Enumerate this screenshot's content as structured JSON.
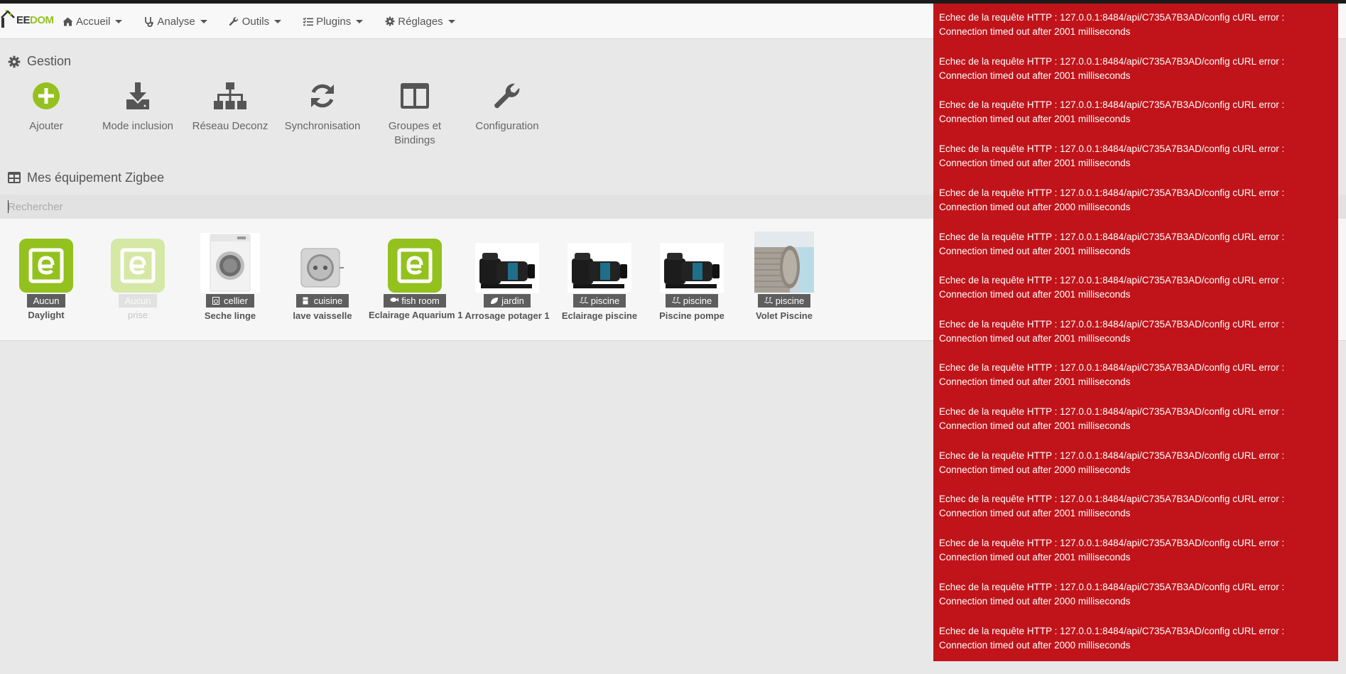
{
  "navbar": {
    "logo": {
      "part1": "EE",
      "part2": "DOM"
    },
    "menu": [
      {
        "label": "Accueil",
        "icon": "home-icon"
      },
      {
        "label": "Analyse",
        "icon": "stethoscope-icon"
      },
      {
        "label": "Outils",
        "icon": "wrench-icon"
      },
      {
        "label": "Plugins",
        "icon": "tasks-icon"
      },
      {
        "label": "Réglages",
        "icon": "gear-icon"
      }
    ]
  },
  "gestion": {
    "title": "Gestion",
    "actions": [
      {
        "label": "Ajouter",
        "icon": "plus-circle-icon",
        "color": "#94c11f"
      },
      {
        "label": "Mode inclusion",
        "icon": "download-icon"
      },
      {
        "label": "Réseau Deconz",
        "icon": "sitemap-icon"
      },
      {
        "label": "Synchronisation",
        "icon": "refresh-icon"
      },
      {
        "label": "Groupes et Bindings",
        "label_line1": "Groupes et",
        "label_line2": "Bindings",
        "icon": "columns-icon"
      },
      {
        "label": "Configuration",
        "icon": "wrench-icon"
      }
    ]
  },
  "equipements": {
    "title": "Mes équipement Zigbee",
    "search_placeholder": "Rechercher",
    "items": [
      {
        "badge": "Aucun",
        "name": "Daylight",
        "image": "jeedom-logo",
        "enabled": true
      },
      {
        "badge": "Aucun",
        "name": "prise",
        "image": "jeedom-logo",
        "enabled": false
      },
      {
        "badge": "cellier",
        "name": "Seche linge",
        "image": "washing-machine",
        "badge_icon": "laundry-icon",
        "enabled": true
      },
      {
        "badge": "cuisine",
        "name": "lave vaisselle",
        "image": "smart-plug",
        "badge_icon": "fridge-icon",
        "enabled": true
      },
      {
        "badge": "fish room",
        "name": "Eclairage Aquarium 1",
        "image": "jeedom-logo",
        "badge_icon": "fish-icon",
        "enabled": true
      },
      {
        "badge": "jardin",
        "name": "Arrosage potager 1",
        "image": "pool-pump",
        "badge_icon": "leaf-icon",
        "enabled": true
      },
      {
        "badge": "piscine",
        "name": "Eclairage piscine",
        "image": "pool-pump",
        "badge_icon": "pool-icon",
        "enabled": true
      },
      {
        "badge": "piscine",
        "name": "Piscine pompe",
        "image": "pool-pump",
        "badge_icon": "pool-icon",
        "enabled": true
      },
      {
        "badge": "piscine",
        "name": "Volet Piscine",
        "image": "pool-cover",
        "badge_icon": "pool-icon",
        "enabled": true
      }
    ]
  },
  "notifications": {
    "color": "#c0141a",
    "messages": [
      {
        "line1": "Echec de la requête HTTP : 127.0.0.1:8484/api/C735A7B3AD/config cURL error :",
        "line2": "Connection timed out after 2001 milliseconds"
      },
      {
        "line1": "Echec de la requête HTTP : 127.0.0.1:8484/api/C735A7B3AD/config cURL error :",
        "line2": "Connection timed out after 2001 milliseconds"
      },
      {
        "line1": "Echec de la requête HTTP : 127.0.0.1:8484/api/C735A7B3AD/config cURL error :",
        "line2": "Connection timed out after 2001 milliseconds"
      },
      {
        "line1": "Echec de la requête HTTP : 127.0.0.1:8484/api/C735A7B3AD/config cURL error :",
        "line2": "Connection timed out after 2001 milliseconds"
      },
      {
        "line1": "Echec de la requête HTTP : 127.0.0.1:8484/api/C735A7B3AD/config cURL error :",
        "line2": "Connection timed out after 2000 milliseconds"
      },
      {
        "line1": "Echec de la requête HTTP : 127.0.0.1:8484/api/C735A7B3AD/config cURL error :",
        "line2": "Connection timed out after 2001 milliseconds"
      },
      {
        "line1": "Echec de la requête HTTP : 127.0.0.1:8484/api/C735A7B3AD/config cURL error :",
        "line2": "Connection timed out after 2001 milliseconds"
      },
      {
        "line1": "Echec de la requête HTTP : 127.0.0.1:8484/api/C735A7B3AD/config cURL error :",
        "line2": "Connection timed out after 2001 milliseconds"
      },
      {
        "line1": "Echec de la requête HTTP : 127.0.0.1:8484/api/C735A7B3AD/config cURL error :",
        "line2": "Connection timed out after 2001 milliseconds"
      },
      {
        "line1": "Echec de la requête HTTP : 127.0.0.1:8484/api/C735A7B3AD/config cURL error :",
        "line2": "Connection timed out after 2001 milliseconds"
      },
      {
        "line1": "Echec de la requête HTTP : 127.0.0.1:8484/api/C735A7B3AD/config cURL error :",
        "line2": "Connection timed out after 2000 milliseconds"
      },
      {
        "line1": "Echec de la requête HTTP : 127.0.0.1:8484/api/C735A7B3AD/config cURL error :",
        "line2": "Connection timed out after 2001 milliseconds"
      },
      {
        "line1": "Echec de la requête HTTP : 127.0.0.1:8484/api/C735A7B3AD/config cURL error :",
        "line2": "Connection timed out after 2001 milliseconds"
      },
      {
        "line1": "Echec de la requête HTTP : 127.0.0.1:8484/api/C735A7B3AD/config cURL error :",
        "line2": "Connection timed out after 2000 milliseconds"
      },
      {
        "line1": "Echec de la requête HTTP : 127.0.0.1:8484/api/C735A7B3AD/config cURL error :",
        "line2": "Connection timed out after 2000 milliseconds"
      }
    ]
  }
}
